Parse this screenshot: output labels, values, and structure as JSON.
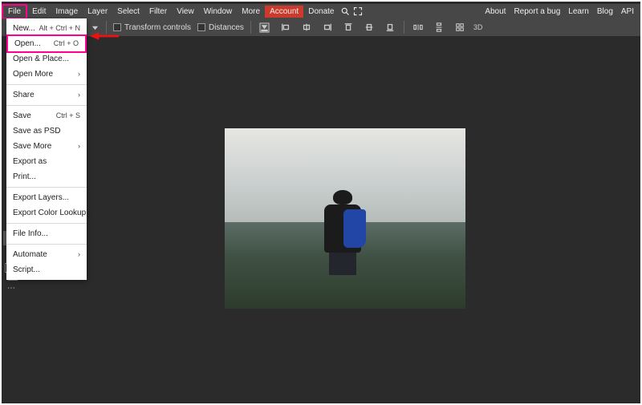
{
  "menubar": {
    "left": [
      {
        "label": "File"
      },
      {
        "label": "Edit"
      },
      {
        "label": "Image"
      },
      {
        "label": "Layer"
      },
      {
        "label": "Select"
      },
      {
        "label": "Filter"
      },
      {
        "label": "View"
      },
      {
        "label": "Window"
      },
      {
        "label": "More"
      },
      {
        "label": "Account"
      },
      {
        "label": "Donate"
      }
    ],
    "right": [
      {
        "label": "About"
      },
      {
        "label": "Report a bug"
      },
      {
        "label": "Learn"
      },
      {
        "label": "Blog"
      },
      {
        "label": "API"
      }
    ],
    "icons": {
      "search": "search-icon",
      "expand": "expand-icon"
    }
  },
  "options": {
    "transform_label": "Transform controls",
    "distances_label": "Distances",
    "three_d_label": "3D"
  },
  "file_menu": [
    {
      "kind": "item",
      "label": "New...",
      "shortcut": "Alt + Ctrl + N"
    },
    {
      "kind": "item",
      "label": "Open...",
      "shortcut": "Ctrl + O",
      "highlight": true
    },
    {
      "kind": "item",
      "label": "Open & Place..."
    },
    {
      "kind": "item",
      "label": "Open More",
      "submenu": true
    },
    {
      "kind": "sep"
    },
    {
      "kind": "item",
      "label": "Share",
      "submenu": true
    },
    {
      "kind": "sep"
    },
    {
      "kind": "item",
      "label": "Save",
      "shortcut": "Ctrl + S"
    },
    {
      "kind": "item",
      "label": "Save as PSD"
    },
    {
      "kind": "item",
      "label": "Save More",
      "submenu": true
    },
    {
      "kind": "item",
      "label": "Export as"
    },
    {
      "kind": "item",
      "label": "Print..."
    },
    {
      "kind": "sep"
    },
    {
      "kind": "item",
      "label": "Export Layers..."
    },
    {
      "kind": "item",
      "label": "Export Color Lookup..."
    },
    {
      "kind": "sep"
    },
    {
      "kind": "item",
      "label": "File Info..."
    },
    {
      "kind": "sep"
    },
    {
      "kind": "item",
      "label": "Automate",
      "submenu": true
    },
    {
      "kind": "item",
      "label": "Script..."
    }
  ],
  "tools": {
    "items": [
      "move",
      "hand",
      "zoom",
      "color",
      "swatches",
      "ellipsis"
    ]
  }
}
